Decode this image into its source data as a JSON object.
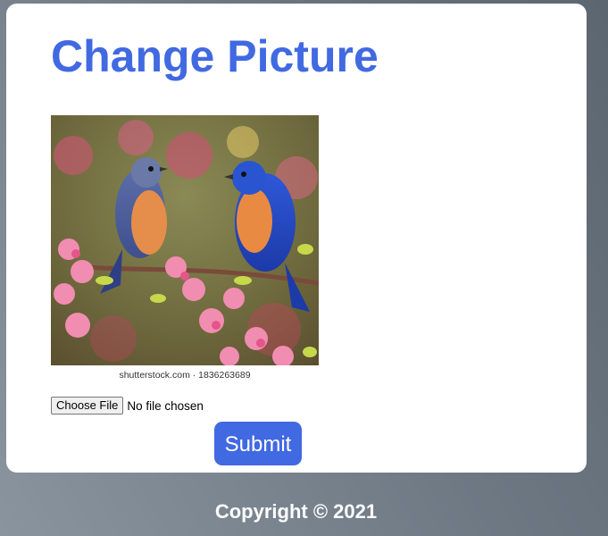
{
  "page": {
    "title": "Change Picture"
  },
  "image": {
    "description_icon": "bird-photo",
    "watermark": "shutterstock.com · 1836263689"
  },
  "file_input": {
    "button_label": "Choose File",
    "status": "No file chosen"
  },
  "submit": {
    "label": "Submit"
  },
  "footer": {
    "copyright": "Copyright © 2021"
  },
  "colors": {
    "accent": "#4169e1",
    "card": "#ffffff",
    "background": "#6e7883"
  }
}
